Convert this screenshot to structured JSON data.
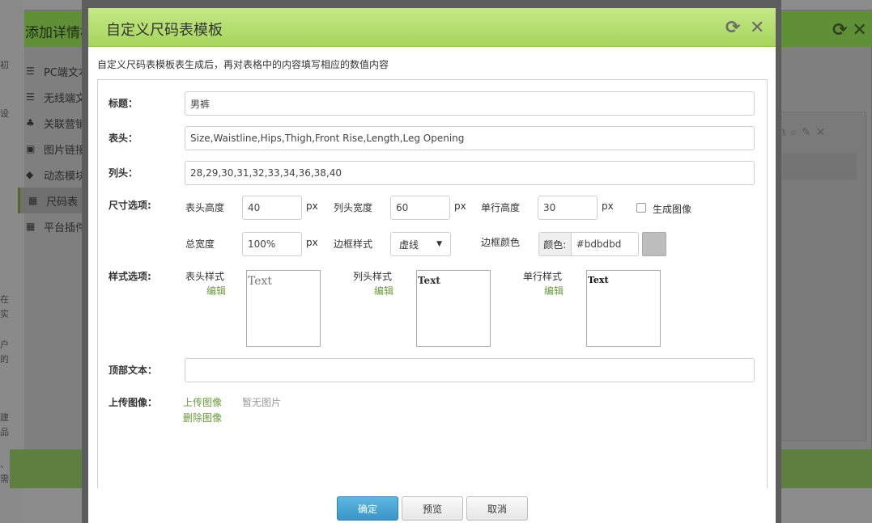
{
  "background": {
    "window_title": "添加详情模",
    "menu_items": [
      {
        "label": "PC端文本",
        "icon": "align-left-icon",
        "glyph": "☰"
      },
      {
        "label": "无线端文",
        "icon": "align-left-icon",
        "glyph": "☰"
      },
      {
        "label": "关联营销",
        "icon": "sitemap-icon",
        "glyph": "♣"
      },
      {
        "label": "图片链接",
        "icon": "image-icon",
        "glyph": "▣"
      },
      {
        "label": "动态模块",
        "icon": "tag-icon",
        "glyph": "◆"
      },
      {
        "label": "尺码表",
        "icon": "table-icon",
        "glyph": "▦",
        "active": true
      },
      {
        "label": "平台插件",
        "icon": "table-icon",
        "glyph": "▦"
      }
    ],
    "left_strip_texts": [
      "初",
      "设",
      "在",
      "实",
      "户",
      "的",
      "建",
      "品",
      "、",
      "需"
    ]
  },
  "modal": {
    "title": "自定义尺码表模板",
    "hint": "自定义尺码表模板表生成后，再对表格中的内容填写相应的数值内容",
    "fields": {
      "title_label": "标题：",
      "title_value": "男裤",
      "header_label": "表头：",
      "header_value": "Size,Waistline,Hips,Thigh,Front Rise,Length,Leg Opening",
      "column_label": "列头：",
      "column_value": "28,29,30,31,32,33,34,36,38,40",
      "size_label": "尺寸选项:",
      "header_height_label": "表头高度",
      "header_height_value": "40",
      "column_width_label": "列头宽度",
      "column_width_value": "60",
      "row_height_label": "单行高度",
      "row_height_value": "30",
      "px_unit": "px",
      "gen_image_label": "生成图像",
      "total_width_label": "总宽度",
      "total_width_value": "100%",
      "border_style_label": "边框样式",
      "border_style_value": "虚线",
      "border_color_label": "边框颜色",
      "color_addon": "颜色:",
      "border_color_value": "#bdbdbd",
      "style_label": "样式选项:",
      "header_style_label": "表头样式",
      "column_style_label": "列头样式",
      "row_style_label": "单行样式",
      "edit_label": "编辑",
      "preview_text": "Text",
      "top_text_label": "顶部文本：",
      "top_text_value": "",
      "upload_label": "上传图像：",
      "upload_link": "上传图像",
      "delete_link": "删除图像",
      "no_image": "暂无图片"
    },
    "buttons": {
      "confirm": "确定",
      "preview": "预览",
      "cancel": "取消"
    }
  },
  "colors": {
    "accent_green": "#a6d55c",
    "link_green": "#6a9a3a",
    "primary_blue": "#3a95c7",
    "swatch": "#bdbdbd"
  }
}
